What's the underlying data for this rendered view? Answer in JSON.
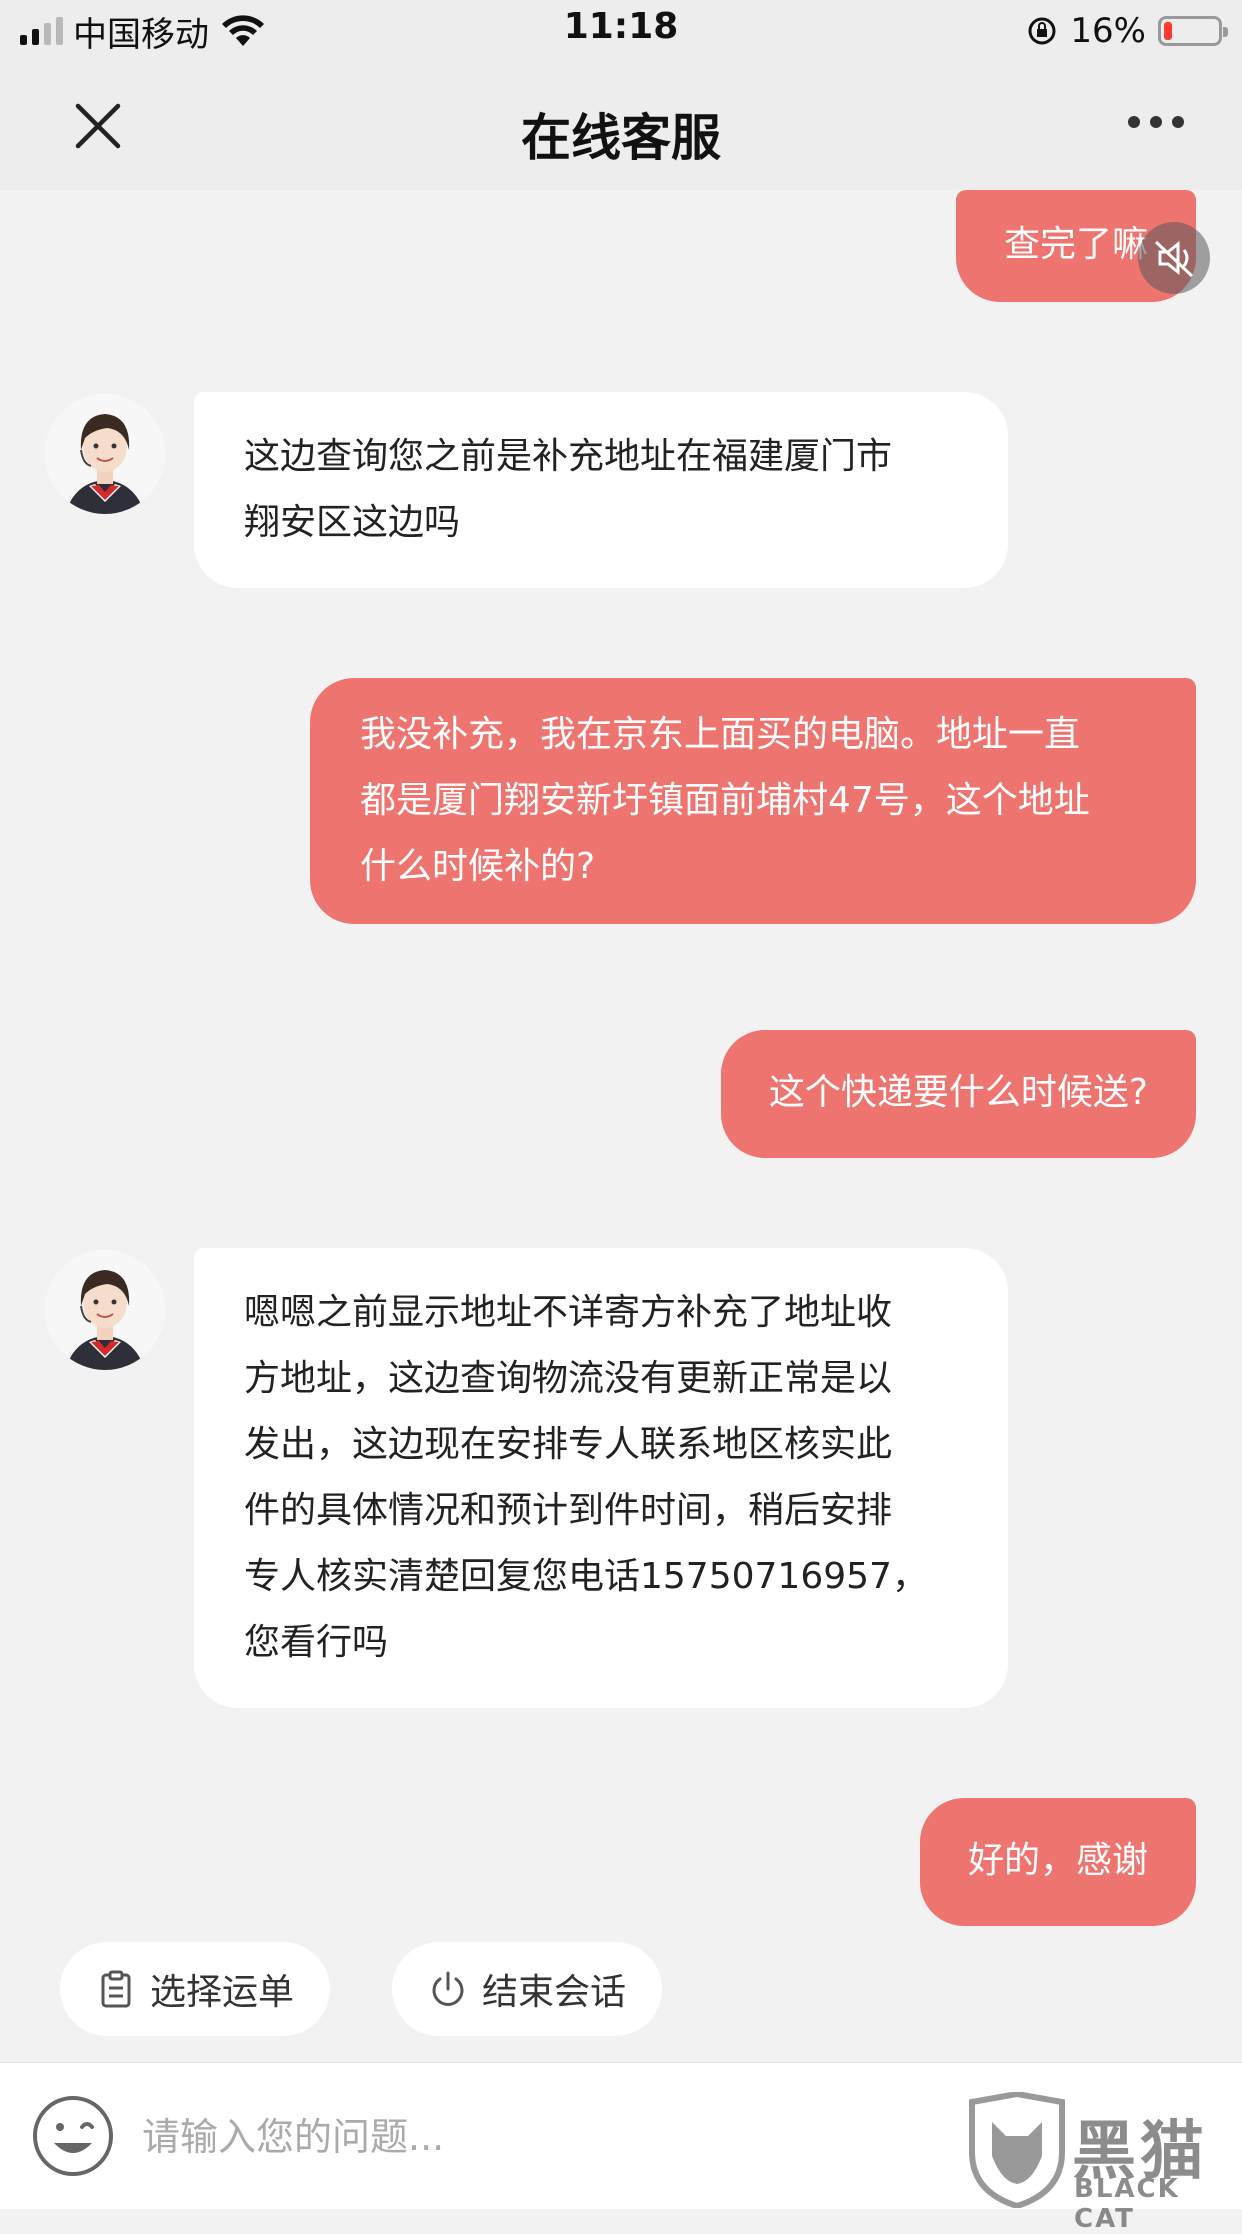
{
  "status_bar": {
    "carrier": "中国移动",
    "time": "11:18",
    "battery_percent": "16%",
    "signal_bars_active": 2,
    "battery_level": 0.16
  },
  "nav": {
    "title": "在线客服",
    "close_icon": "close-icon",
    "more_icon": "more-icon"
  },
  "messages": [
    {
      "sender": "user",
      "text": "查完了嘛"
    },
    {
      "sender": "agent",
      "lines": [
        "这边查询您之前是补充地址在福建厦门市",
        "翔安区这边吗"
      ]
    },
    {
      "sender": "user",
      "lines": [
        "我没补充，我在京东上面买的电脑。地址一直",
        "都是厦门翔安新圩镇面前埔村47号，这个地址",
        "什么时候补的?"
      ]
    },
    {
      "sender": "user",
      "text": "这个快递要什么时候送?"
    },
    {
      "sender": "agent",
      "lines": [
        "嗯嗯之前显示地址不详寄方补充了地址收",
        "方地址，这边查询物流没有更新正常是以",
        "发出，这边现在安排专人联系地区核实此",
        "件的具体情况和预计到件时间，稍后安排",
        "专人核实清楚回复您电话15750716957，",
        "您看行吗"
      ]
    },
    {
      "sender": "user",
      "text": "好的，感谢"
    }
  ],
  "quick_actions": [
    {
      "label": "选择运单",
      "icon": "clipboard-icon"
    },
    {
      "label": "结束会话",
      "icon": "power-icon"
    }
  ],
  "input": {
    "placeholder": "请输入您的问题...",
    "emoji_icon": "emoji-icon"
  },
  "watermark": {
    "text": "黑猫",
    "sub": "BLACK CAT"
  },
  "colors": {
    "user_bubble": "#ee7470",
    "agent_bubble": "#ffffff",
    "background": "#f2f2f2",
    "header": "#ededed"
  }
}
